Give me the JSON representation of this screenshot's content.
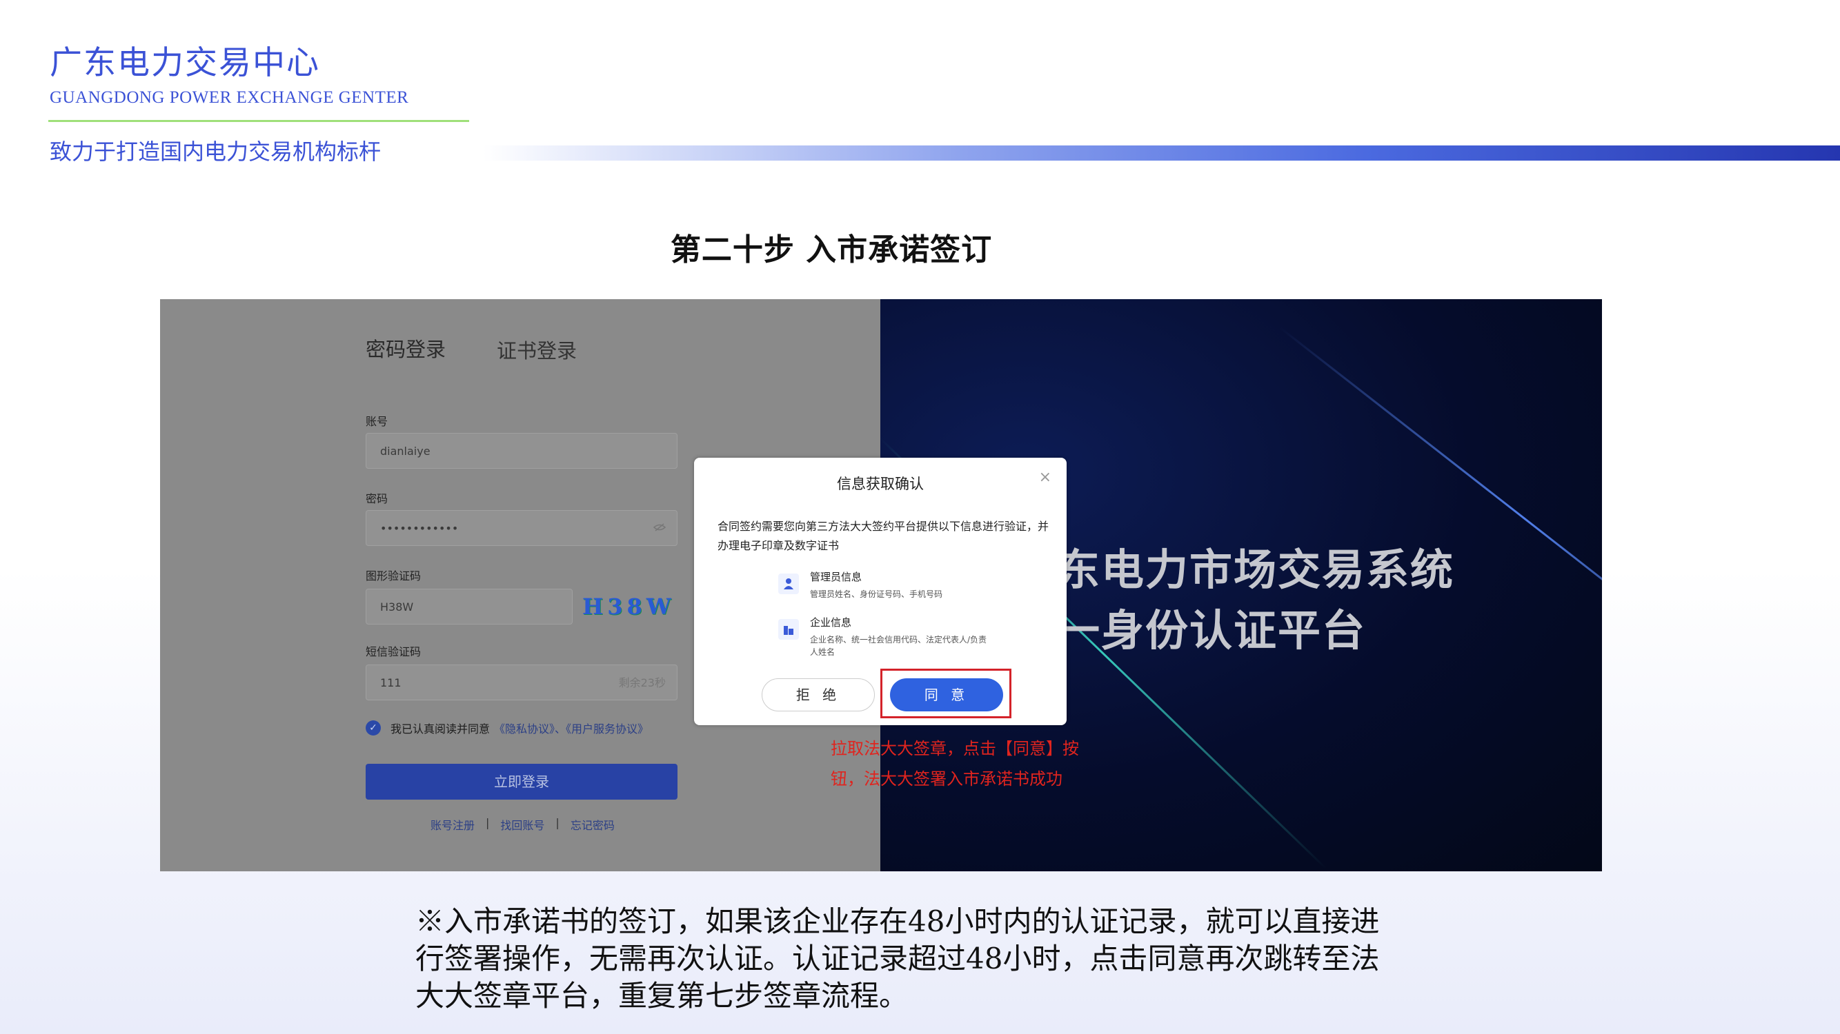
{
  "header": {
    "org_name": "广东电力交易中心",
    "org_name_en": "GUANGDONG POWER EXCHANGE GENTER",
    "slogan": "致力于打造国内电力交易机构标杆"
  },
  "step_title": "第二十步  入市承诺签订",
  "screenshot": {
    "login": {
      "tabs": [
        "密码登录",
        "证书登录"
      ],
      "account_label": "账号",
      "account_value": "dianlaiye",
      "password_label": "密码",
      "password_value": "••••••••••••",
      "password_icon": "eye-off-icon",
      "captcha_label": "图形验证码",
      "captcha_value": "H38W",
      "captcha_image_text": "H38W",
      "sms_label": "短信验证码",
      "sms_value": "111",
      "sms_countdown": "剩余23秒",
      "agree_text": "我已认真阅读并同意",
      "agree_links": "《隐私协议》、《用户服务协议》",
      "login_button": "立即登录",
      "links": [
        "账号注册",
        "找回账号",
        "忘记密码"
      ],
      "link_separator": "|"
    },
    "banner": {
      "title_line1": "东电力市场交易系统",
      "title_line2": "一身份认证平台"
    },
    "dialog": {
      "title": "信息获取确认",
      "close": "×",
      "description": "合同签约需要您向第三方法大大签约平台提供以下信息进行验证，并办理电子印章及数字证书",
      "items": [
        {
          "icon": "user-icon",
          "name": "管理员信息",
          "detail": "管理员姓名、身份证号码、手机号码"
        },
        {
          "icon": "building-icon",
          "name": "企业信息",
          "detail": "企业名称、统一社会信用代码、法定代表人/负责人姓名"
        }
      ],
      "refuse_button": "拒 绝",
      "agree_button": "同 意"
    },
    "annotation": "拉取法大大签章，点击【同意】按钮，法大大签署入市承诺书成功"
  },
  "note": "※入市承诺书的签订，如果该企业存在48小时内的认证记录，就可以直接进行签署操作，无需再次认证。认证记录超过48小时，点击同意再次跳转至法大大签章平台，重复第七步签章流程。",
  "colors": {
    "brand": "#3b52d6",
    "accent_line": "#9fe07a",
    "annotation": "#e0241e",
    "agree_button": "#2f62e0"
  }
}
